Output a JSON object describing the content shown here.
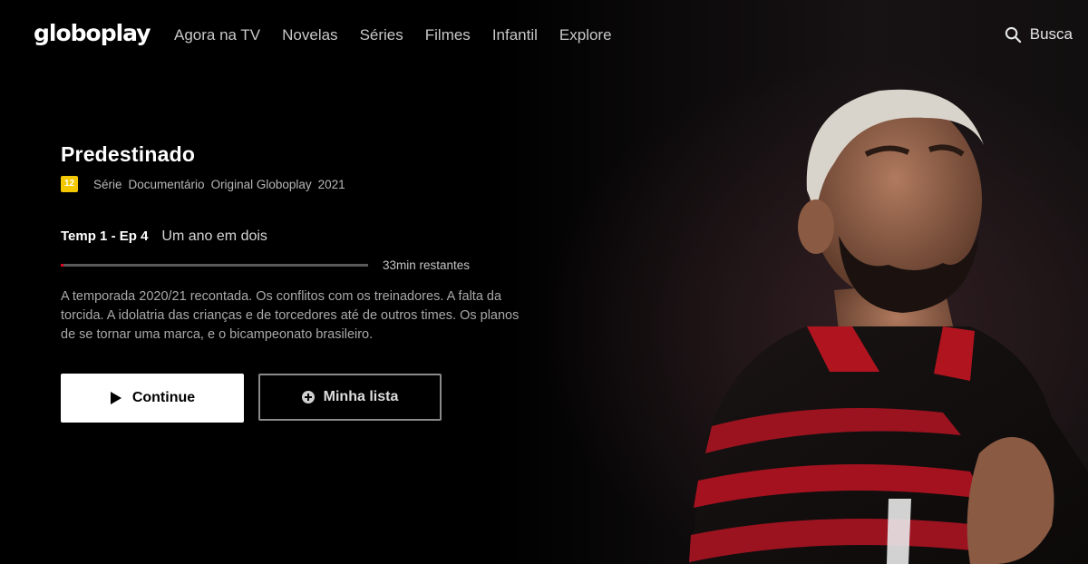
{
  "header": {
    "logo": "globoplay",
    "nav": [
      "Agora na TV",
      "Novelas",
      "Séries",
      "Filmes",
      "Infantil",
      "Explore"
    ],
    "search_label": "Busca"
  },
  "hero": {
    "title": "Predestinado",
    "age_rating": "12",
    "age_rating_color": "#f3c800",
    "meta": [
      "Série",
      "Documentário",
      "Original Globoplay",
      "2021"
    ],
    "episode": "Temp 1 - Ep 4",
    "episode_title": "Um ano em dois",
    "progress_percent": 1,
    "progress_color": "#e2001a",
    "time_remaining": "33min restantes",
    "description": "A temporada 2020/21 recontada. Os conflitos com os treinadores. A falta da torcida. A idolatria das crianças e de torcedores até de outros times. Os planos de se tornar uma marca, e o bicampeonato brasileiro.",
    "continue_label": "Continue",
    "mylist_label": "Minha lista"
  },
  "icons": {
    "search": "search-icon",
    "play": "play-icon",
    "add": "plus-circle-icon"
  }
}
